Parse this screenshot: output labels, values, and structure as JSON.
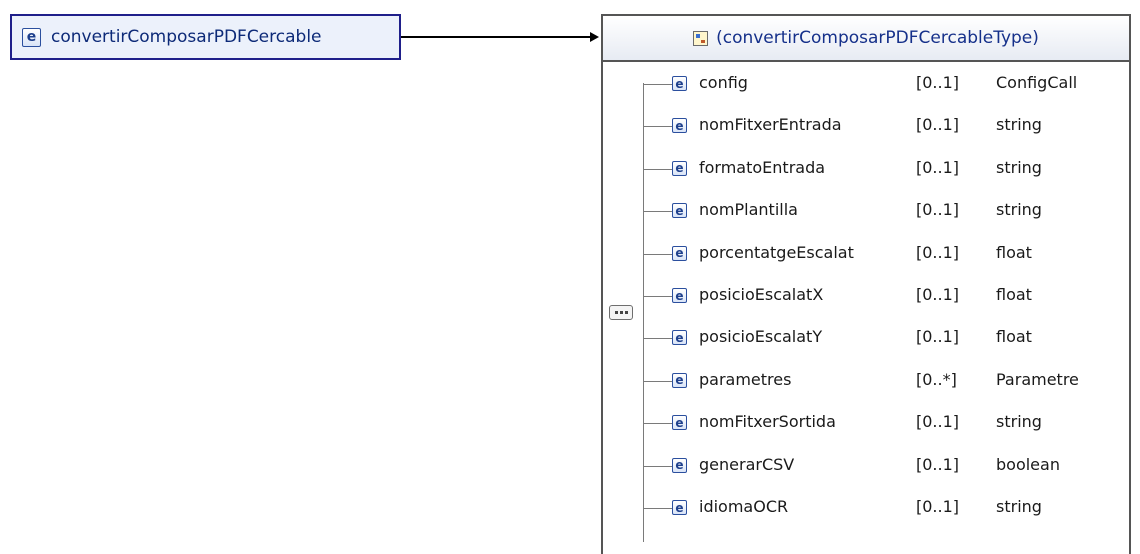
{
  "root": {
    "badge": "e",
    "name": "convertirComposarPDFCercable"
  },
  "type_box": {
    "title": "(convertirComposarPDFCercableType)"
  },
  "children": [
    {
      "badge": "e",
      "name": "config",
      "cardinality": "[0..1]",
      "type": "ConfigCall"
    },
    {
      "badge": "e",
      "name": "nomFitxerEntrada",
      "cardinality": "[0..1]",
      "type": "string"
    },
    {
      "badge": "e",
      "name": "formatoEntrada",
      "cardinality": "[0..1]",
      "type": "string"
    },
    {
      "badge": "e",
      "name": "nomPlantilla",
      "cardinality": "[0..1]",
      "type": "string"
    },
    {
      "badge": "e",
      "name": "porcentatgeEscalat",
      "cardinality": "[0..1]",
      "type": "float"
    },
    {
      "badge": "e",
      "name": "posicioEscalatX",
      "cardinality": "[0..1]",
      "type": "float"
    },
    {
      "badge": "e",
      "name": "posicioEscalatY",
      "cardinality": "[0..1]",
      "type": "float"
    },
    {
      "badge": "e",
      "name": "parametres",
      "cardinality": "[0..*]",
      "type": "Parametre"
    },
    {
      "badge": "e",
      "name": "nomFitxerSortida",
      "cardinality": "[0..1]",
      "type": "string"
    },
    {
      "badge": "e",
      "name": "generarCSV",
      "cardinality": "[0..1]",
      "type": "boolean"
    },
    {
      "badge": "e",
      "name": "idiomaOCR",
      "cardinality": "[0..1]",
      "type": "string"
    }
  ],
  "icons": {
    "element": "element-icon",
    "type": "complex-type-icon",
    "compositor": "sequence-icon"
  }
}
